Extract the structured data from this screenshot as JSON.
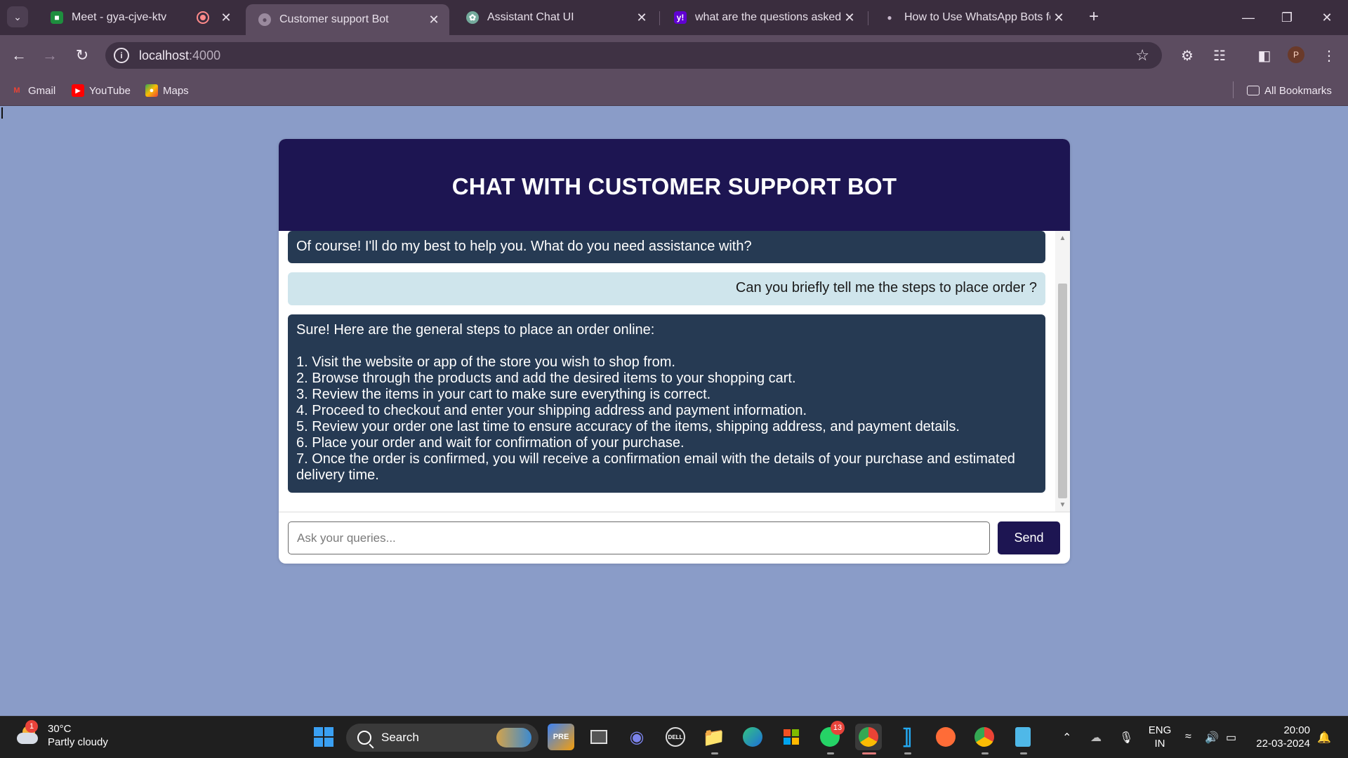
{
  "browser": {
    "tabs": [
      {
        "label": "Meet - gya-cjve-ktv",
        "recording": true
      },
      {
        "label": "Customer support Bot",
        "active": true
      },
      {
        "label": "Assistant Chat UI"
      },
      {
        "label": "what are the questions asked fo"
      },
      {
        "label": "How to Use WhatsApp Bots for"
      }
    ],
    "url_host": "localhost",
    "url_port": ":4000",
    "profile_initial": "P",
    "bookmarks": [
      {
        "label": "Gmail",
        "icon": "gmail-icon"
      },
      {
        "label": "YouTube",
        "icon": "youtube-icon"
      },
      {
        "label": "Maps",
        "icon": "maps-icon"
      }
    ],
    "all_bookmarks_label": "All Bookmarks"
  },
  "chat": {
    "title": "CHAT WITH CUSTOMER SUPPORT BOT",
    "messages": [
      {
        "role": "bot",
        "lines": [
          "Of course! I'll do my best to help you. What do you need assistance with?"
        ]
      },
      {
        "role": "user",
        "lines": [
          "Can you briefly tell me the steps to place order ?"
        ]
      },
      {
        "role": "bot",
        "lines": [
          "Sure! Here are the general steps to place an order online:",
          "",
          "1. Visit the website or app of the store you wish to shop from.",
          "2. Browse through the products and add the desired items to your shopping cart.",
          "3. Review the items in your cart to make sure everything is correct.",
          "4. Proceed to checkout and enter your shipping address and payment information.",
          "5. Review your order one last time to ensure accuracy of the items, shipping address, and payment details.",
          "6. Place your order and wait for confirmation of your purchase.",
          "7. Once the order is confirmed, you will receive a confirmation email with the details of your purchase and estimated delivery time."
        ]
      }
    ],
    "input_placeholder": "Ask your queries...",
    "input_value": "",
    "send_label": "Send",
    "colors": {
      "header": "#1d1552",
      "bot_bubble": "#263a53",
      "user_bubble": "#cfe5ec",
      "page_bg": "#8a9cc8"
    }
  },
  "taskbar": {
    "weather_temp": "30°C",
    "weather_desc": "Partly cloudy",
    "weather_badge": "1",
    "search_label": "Search",
    "whatsapp_badge": "13",
    "language": "ENG",
    "region": "IN",
    "time": "20:00",
    "date": "22-03-2024"
  }
}
